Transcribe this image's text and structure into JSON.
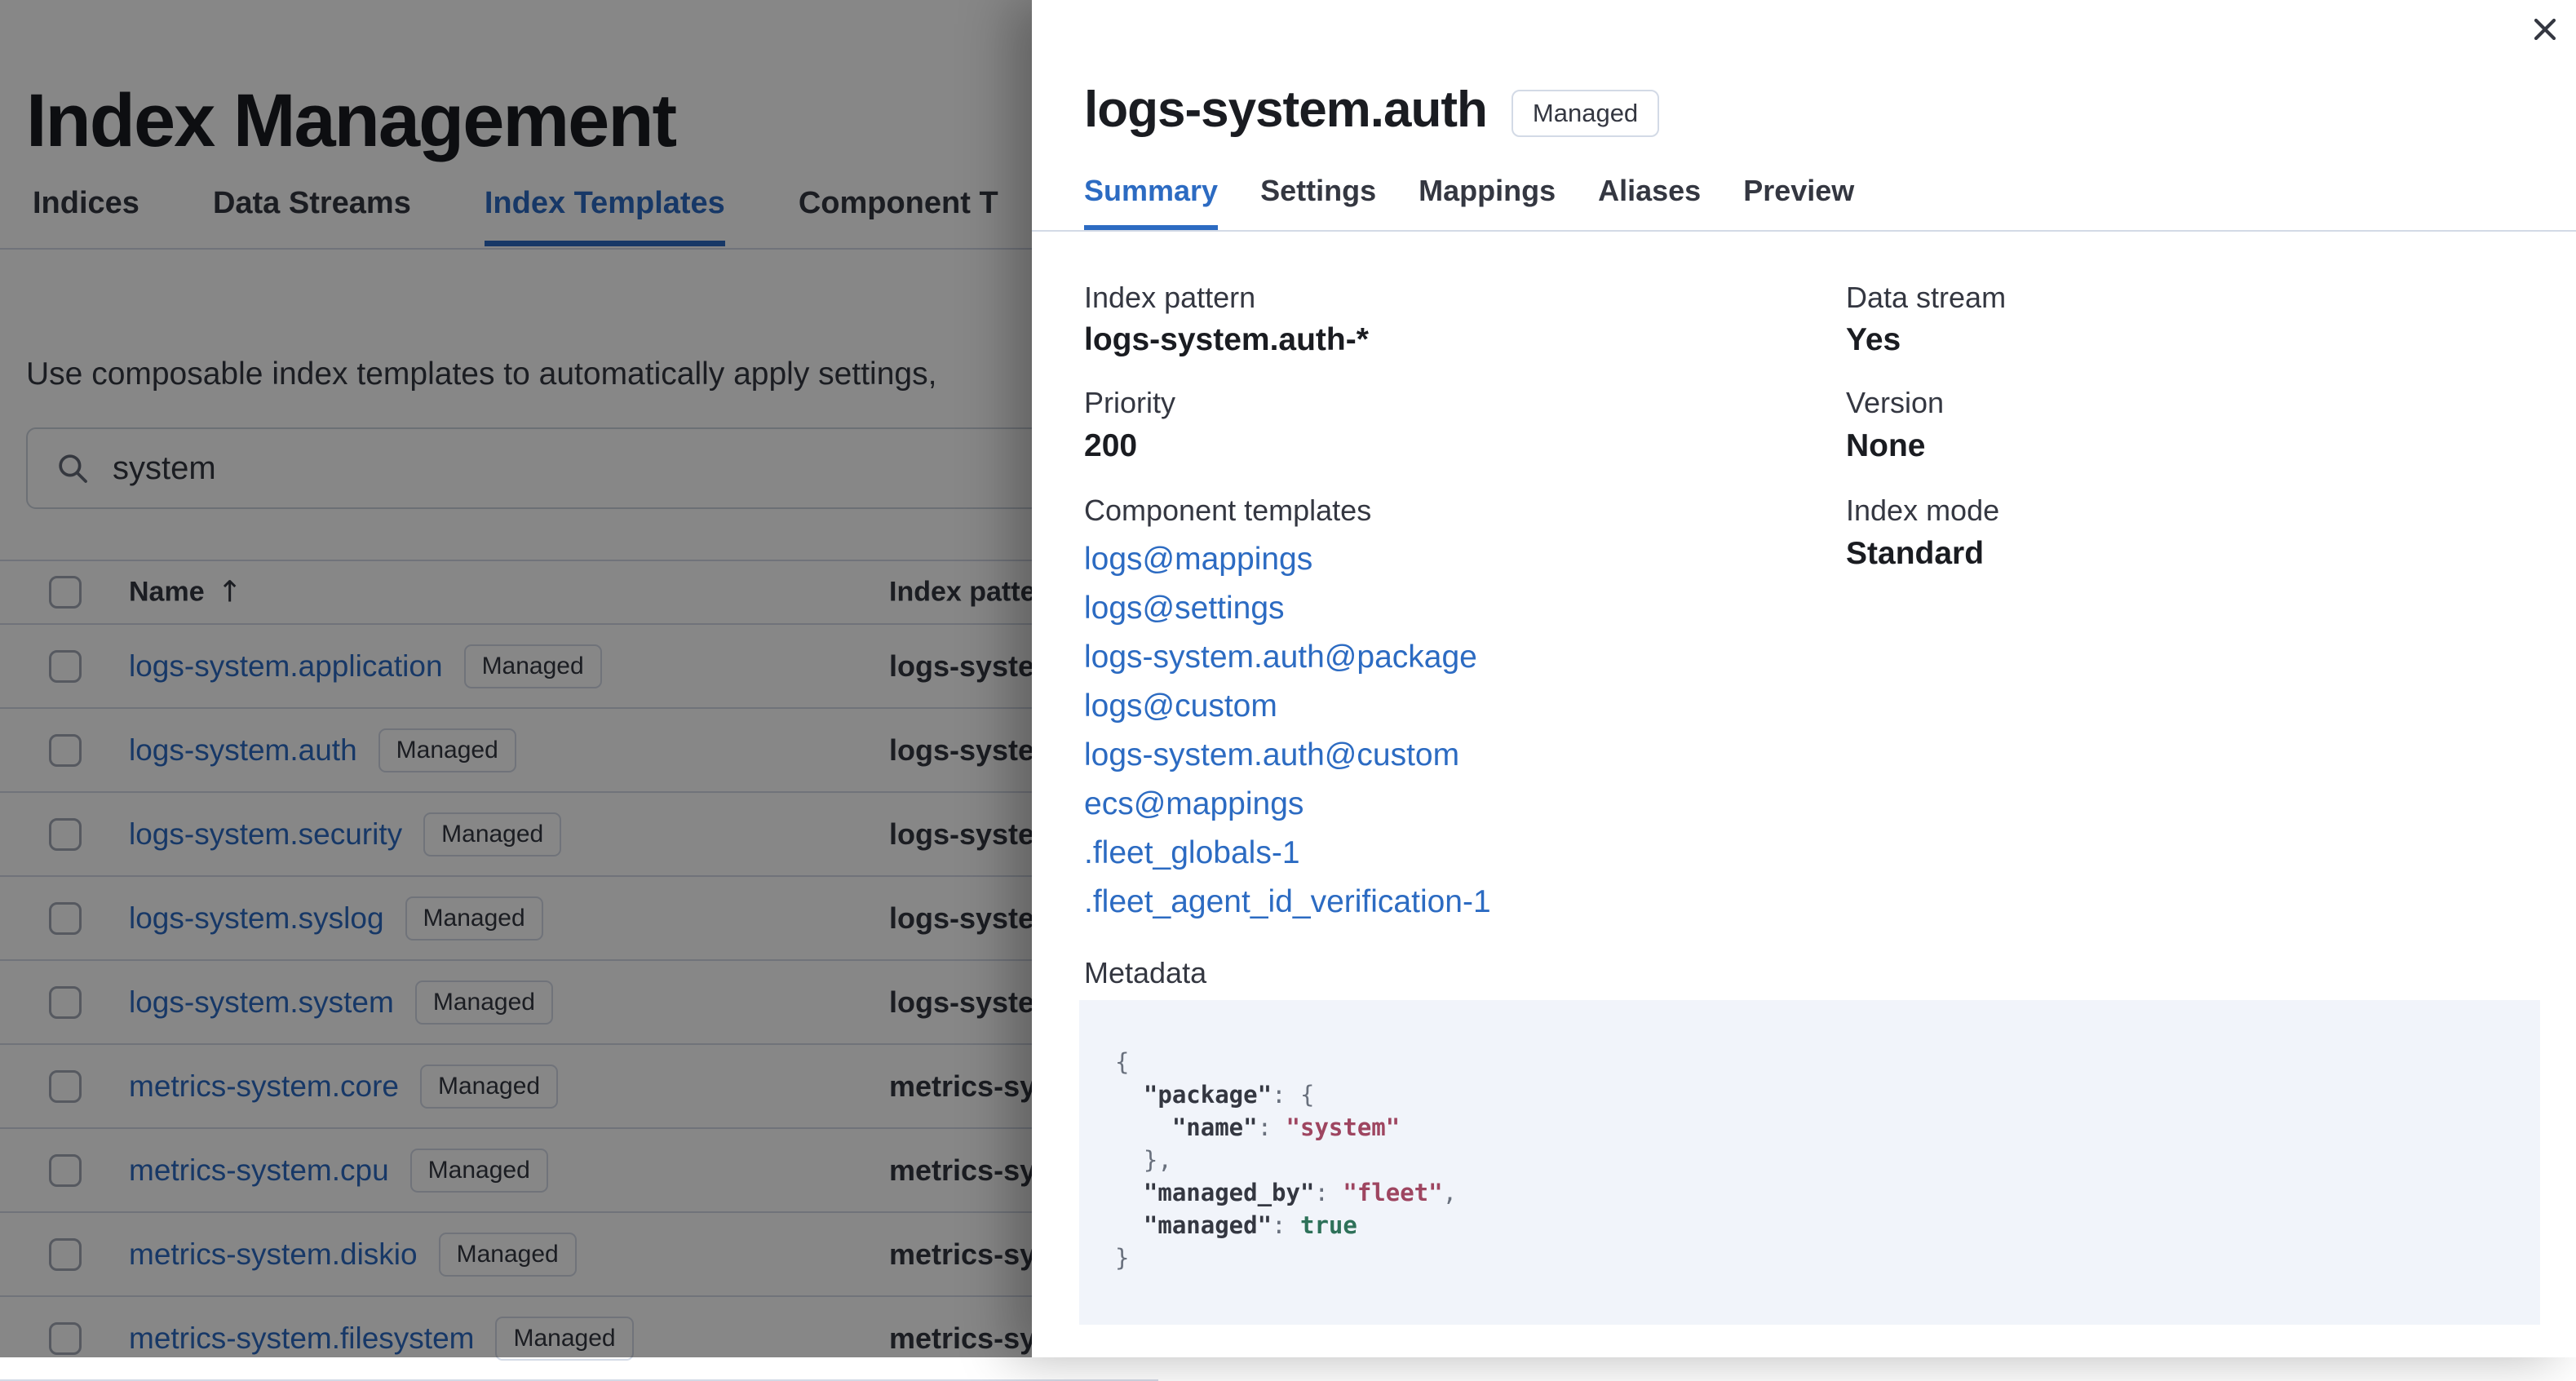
{
  "page": {
    "title": "Index Management",
    "tabs": [
      {
        "label": "Indices",
        "active": false
      },
      {
        "label": "Data Streams",
        "active": false
      },
      {
        "label": "Index Templates",
        "active": true
      },
      {
        "label": "Component T",
        "active": false
      }
    ],
    "description": "Use composable index templates to automatically apply settings,",
    "search": {
      "value": "system",
      "icon": "search-icon"
    },
    "table": {
      "header": {
        "name": "Name",
        "sort_icon": "up-arrow",
        "sort_glyph": "↑",
        "index_patterns": "Index patter"
      },
      "rows": [
        {
          "name": "logs-system.application",
          "badge": "Managed",
          "index_pattern": "logs-syste"
        },
        {
          "name": "logs-system.auth",
          "badge": "Managed",
          "index_pattern": "logs-syste"
        },
        {
          "name": "logs-system.security",
          "badge": "Managed",
          "index_pattern": "logs-syste"
        },
        {
          "name": "logs-system.syslog",
          "badge": "Managed",
          "index_pattern": "logs-syste"
        },
        {
          "name": "logs-system.system",
          "badge": "Managed",
          "index_pattern": "logs-syste"
        },
        {
          "name": "metrics-system.core",
          "badge": "Managed",
          "index_pattern": "metrics-sy"
        },
        {
          "name": "metrics-system.cpu",
          "badge": "Managed",
          "index_pattern": "metrics-sy"
        },
        {
          "name": "metrics-system.diskio",
          "badge": "Managed",
          "index_pattern": "metrics-sy"
        },
        {
          "name": "metrics-system.filesystem",
          "badge": "Managed",
          "index_pattern": "metrics-sy"
        }
      ]
    }
  },
  "flyout": {
    "title": "logs-system.auth",
    "badge": "Managed",
    "close_icon": "close-icon",
    "tabs": [
      {
        "label": "Summary",
        "active": true
      },
      {
        "label": "Settings",
        "active": false
      },
      {
        "label": "Mappings",
        "active": false
      },
      {
        "label": "Aliases",
        "active": false
      },
      {
        "label": "Preview",
        "active": false
      }
    ],
    "summary": {
      "index_pattern": {
        "label": "Index pattern",
        "value": "logs-system.auth-*"
      },
      "priority": {
        "label": "Priority",
        "value": "200"
      },
      "component_templates": {
        "label": "Component templates",
        "links": [
          "logs@mappings",
          "logs@settings",
          "logs-system.auth@package",
          "logs@custom",
          "logs-system.auth@custom",
          "ecs@mappings",
          ".fleet_globals-1",
          ".fleet_agent_id_verification-1"
        ]
      },
      "data_stream": {
        "label": "Data stream",
        "value": "Yes"
      },
      "version": {
        "label": "Version",
        "value": "None"
      },
      "index_mode": {
        "label": "Index mode",
        "value": "Standard"
      },
      "metadata": {
        "label": "Metadata",
        "code_lines": [
          [
            {
              "c": "p",
              "t": "{"
            }
          ],
          [
            {
              "c": "p",
              "t": "  "
            },
            {
              "c": "k",
              "t": "\"package\""
            },
            {
              "c": "p",
              "t": ": {"
            }
          ],
          [
            {
              "c": "p",
              "t": "    "
            },
            {
              "c": "k",
              "t": "\"name\""
            },
            {
              "c": "p",
              "t": ": "
            },
            {
              "c": "s",
              "t": "\"system\""
            }
          ],
          [
            {
              "c": "p",
              "t": "  },"
            }
          ],
          [
            {
              "c": "p",
              "t": "  "
            },
            {
              "c": "k",
              "t": "\"managed_by\""
            },
            {
              "c": "p",
              "t": ": "
            },
            {
              "c": "s",
              "t": "\"fleet\""
            },
            {
              "c": "p",
              "t": ","
            }
          ],
          [
            {
              "c": "p",
              "t": "  "
            },
            {
              "c": "k",
              "t": "\"managed\""
            },
            {
              "c": "p",
              "t": ": "
            },
            {
              "c": "b",
              "t": "true"
            }
          ],
          [
            {
              "c": "p",
              "t": "}"
            }
          ]
        ]
      }
    }
  },
  "colors": {
    "accent": "#2C6BC2",
    "link": "#2C6BC2",
    "text": "#343741",
    "heading": "#1A1C21",
    "border": "#D3DAE6",
    "code_background": "#F1F4FA",
    "code_string": "#9E4560",
    "code_boolean": "#2E7159",
    "code_punctuation": "#69707D",
    "overlay": "rgba(0,0,0,0.47)"
  }
}
